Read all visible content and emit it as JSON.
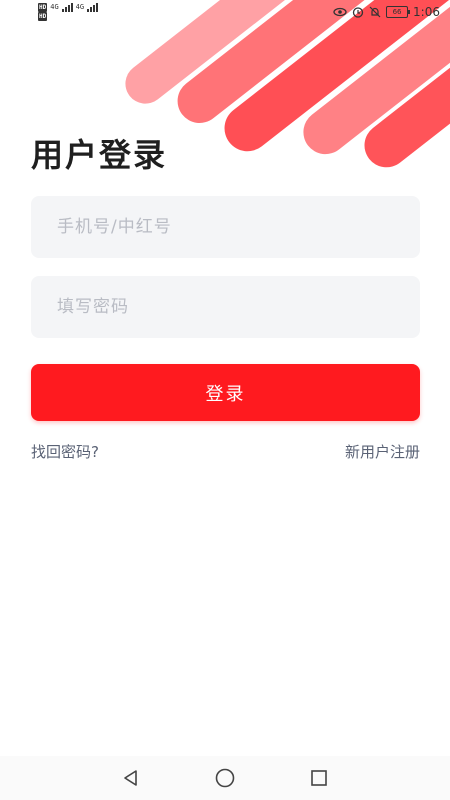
{
  "status_bar": {
    "left_top": {
      "hd": "HD",
      "sim1": "4G",
      "sim2": "4G"
    },
    "left_bottom": {
      "hd": "HD"
    },
    "battery": "66",
    "time": "1:06",
    "icons": [
      "eye-icon",
      "alarm-icon",
      "mute-bell-icon",
      "battery-icon"
    ]
  },
  "login": {
    "title": "用户登录",
    "phone_placeholder": "手机号/中红号",
    "password_placeholder": "填写密码",
    "submit_label": "登录",
    "forgot_label": "找回密码?",
    "register_label": "新用户注册"
  },
  "colors": {
    "accent": "#ff1a1f",
    "field_bg": "#f4f5f7",
    "link": "#5a6275"
  },
  "nav": [
    "back-icon",
    "home-icon",
    "recents-icon"
  ]
}
